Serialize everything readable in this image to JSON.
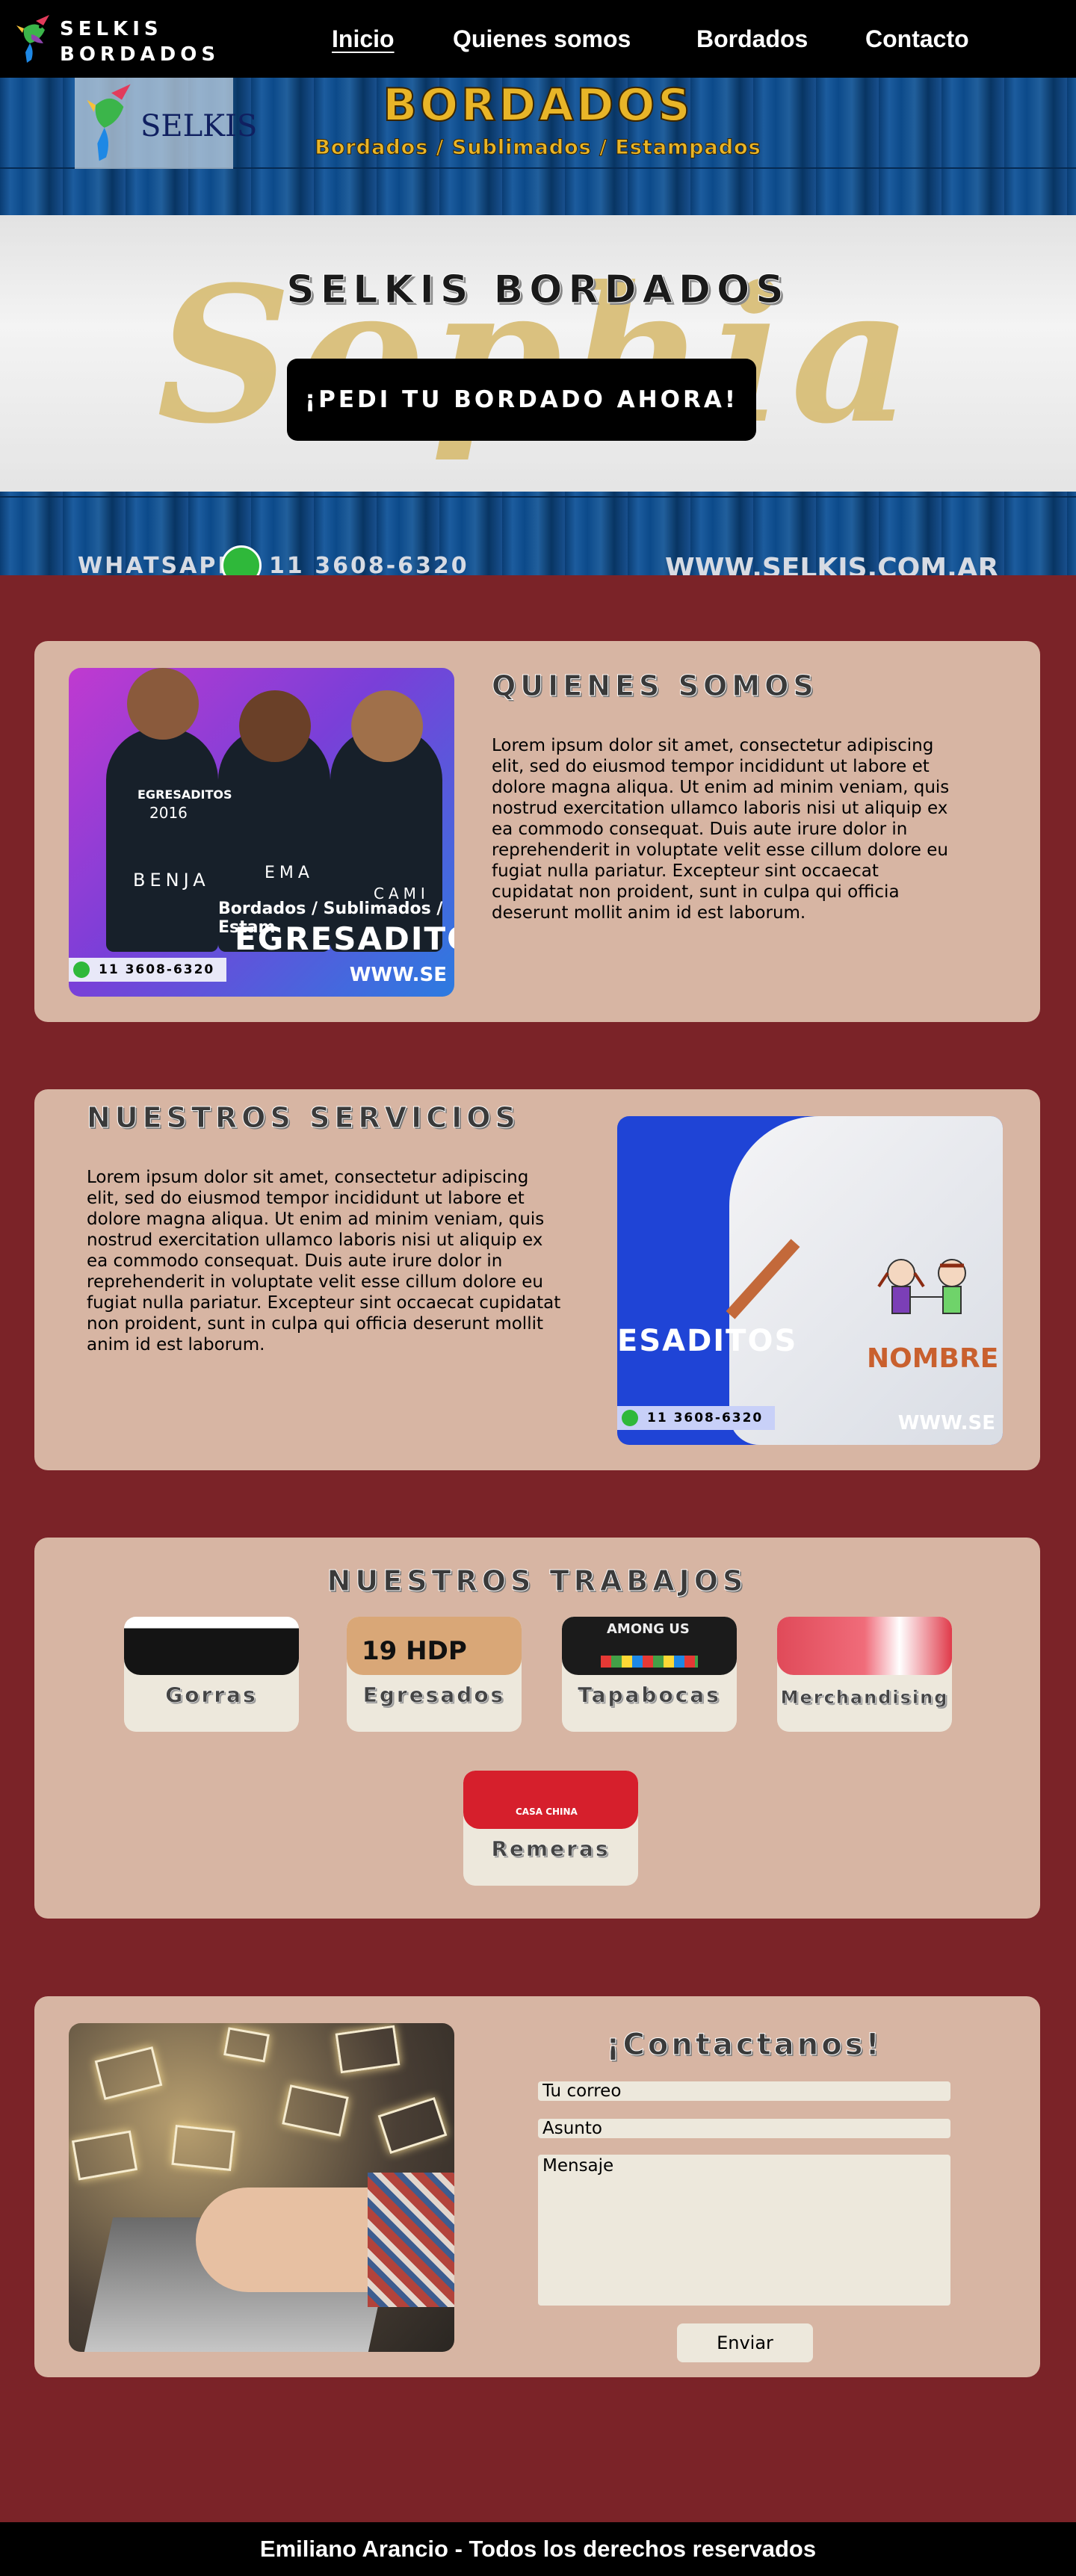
{
  "brand": {
    "line1": "SELKIS",
    "line2": "BORDADOS",
    "logo_icon": "hummingbird-icon"
  },
  "nav": {
    "items": [
      {
        "label": "Inicio",
        "active": true
      },
      {
        "label": "Quienes somos",
        "active": false
      },
      {
        "label": "Bordados",
        "active": false
      },
      {
        "label": "Contacto",
        "active": false
      }
    ]
  },
  "hero": {
    "panel_text": "SELKIS",
    "brand_title": "BORDADOS",
    "brand_subtitle": "Bordados / Sublimados / Estampados",
    "band_script": "Sophia",
    "title": "SELKIS BORDADOS",
    "cta_label": "¡PEDI TU BORDADO AHORA!",
    "whatsapp_label": "WHATSAPP",
    "whatsapp_number": "11 3608-6320",
    "website": "WWW.SELKIS.COM.AR"
  },
  "about": {
    "title": "QUIENES SOMOS",
    "text": "Lorem ipsum dolor sit amet, consectetur adipiscing elit, sed do eiusmod tempor incididunt ut labore et dolore magna aliqua. Ut enim ad minim veniam, quis nostrud exercitation ullamco laboris nisi ut aliquip ex ea commodo consequat. Duis aute irure dolor in reprehenderit in voluptate velit esse cillum dolore eu fugiat nulla pariatur. Excepteur sint occaecat cupidatat non proident, sunt in culpa qui officia deserunt mollit anim id est laborum.",
    "image": {
      "shirt_texts": [
        "EGRESADITOS",
        "2016",
        "BENJA",
        "EMA",
        "CAMI"
      ],
      "caption": "Bordados / Sublimados / Estam",
      "big_text": "EGRESADITO",
      "phone": "11 3608-6320",
      "web": "WWW.SE"
    }
  },
  "services": {
    "title": "NUESTROS SERVICIOS",
    "text": "Lorem ipsum dolor sit amet, consectetur adipiscing elit, sed do eiusmod tempor incididunt ut labore et dolore magna aliqua. Ut enim ad minim veniam, quis nostrud exercitation ullamco laboris nisi ut aliquip ex ea commodo consequat. Duis aute irure dolor in reprehenderit in voluptate velit esse cillum dolore eu fugiat nulla pariatur. Excepteur sint occaecat cupidatat non proident, sunt in culpa qui officia deserunt mollit anim id est laborum.",
    "image": {
      "big_text": "ESADITOS",
      "name_text": "NOMBRE",
      "phone": "11 3608-6320",
      "web": "WWW.SE"
    }
  },
  "works": {
    "title": "NUESTROS TRABAJOS",
    "items": [
      {
        "label": "Gorras",
        "image_text": "",
        "color": "#111111"
      },
      {
        "label": "Egresados",
        "image_text": "19  HDP",
        "color": "#d9a777"
      },
      {
        "label": "Tapabocas",
        "image_text": "AMONG US",
        "color": "#1b1b1b"
      },
      {
        "label": "Merchandising",
        "image_text": "",
        "color": "#e04a59"
      },
      {
        "label": "Remeras",
        "image_text": "CASA CHINA",
        "color": "#d61f2c"
      }
    ]
  },
  "contact": {
    "title": "¡Contactanos!",
    "email_placeholder": "Tu correo",
    "subject_placeholder": "Asunto",
    "message_placeholder": "Mensaje",
    "send_label": "Enviar"
  },
  "footer": {
    "text": "Emiliano Arancio - Todos los derechos reservados"
  },
  "colors": {
    "page_bg": "#7b2328",
    "card_bg": "#d7b5a3",
    "field_bg": "#ede8dc",
    "nav_bg": "#000000"
  }
}
